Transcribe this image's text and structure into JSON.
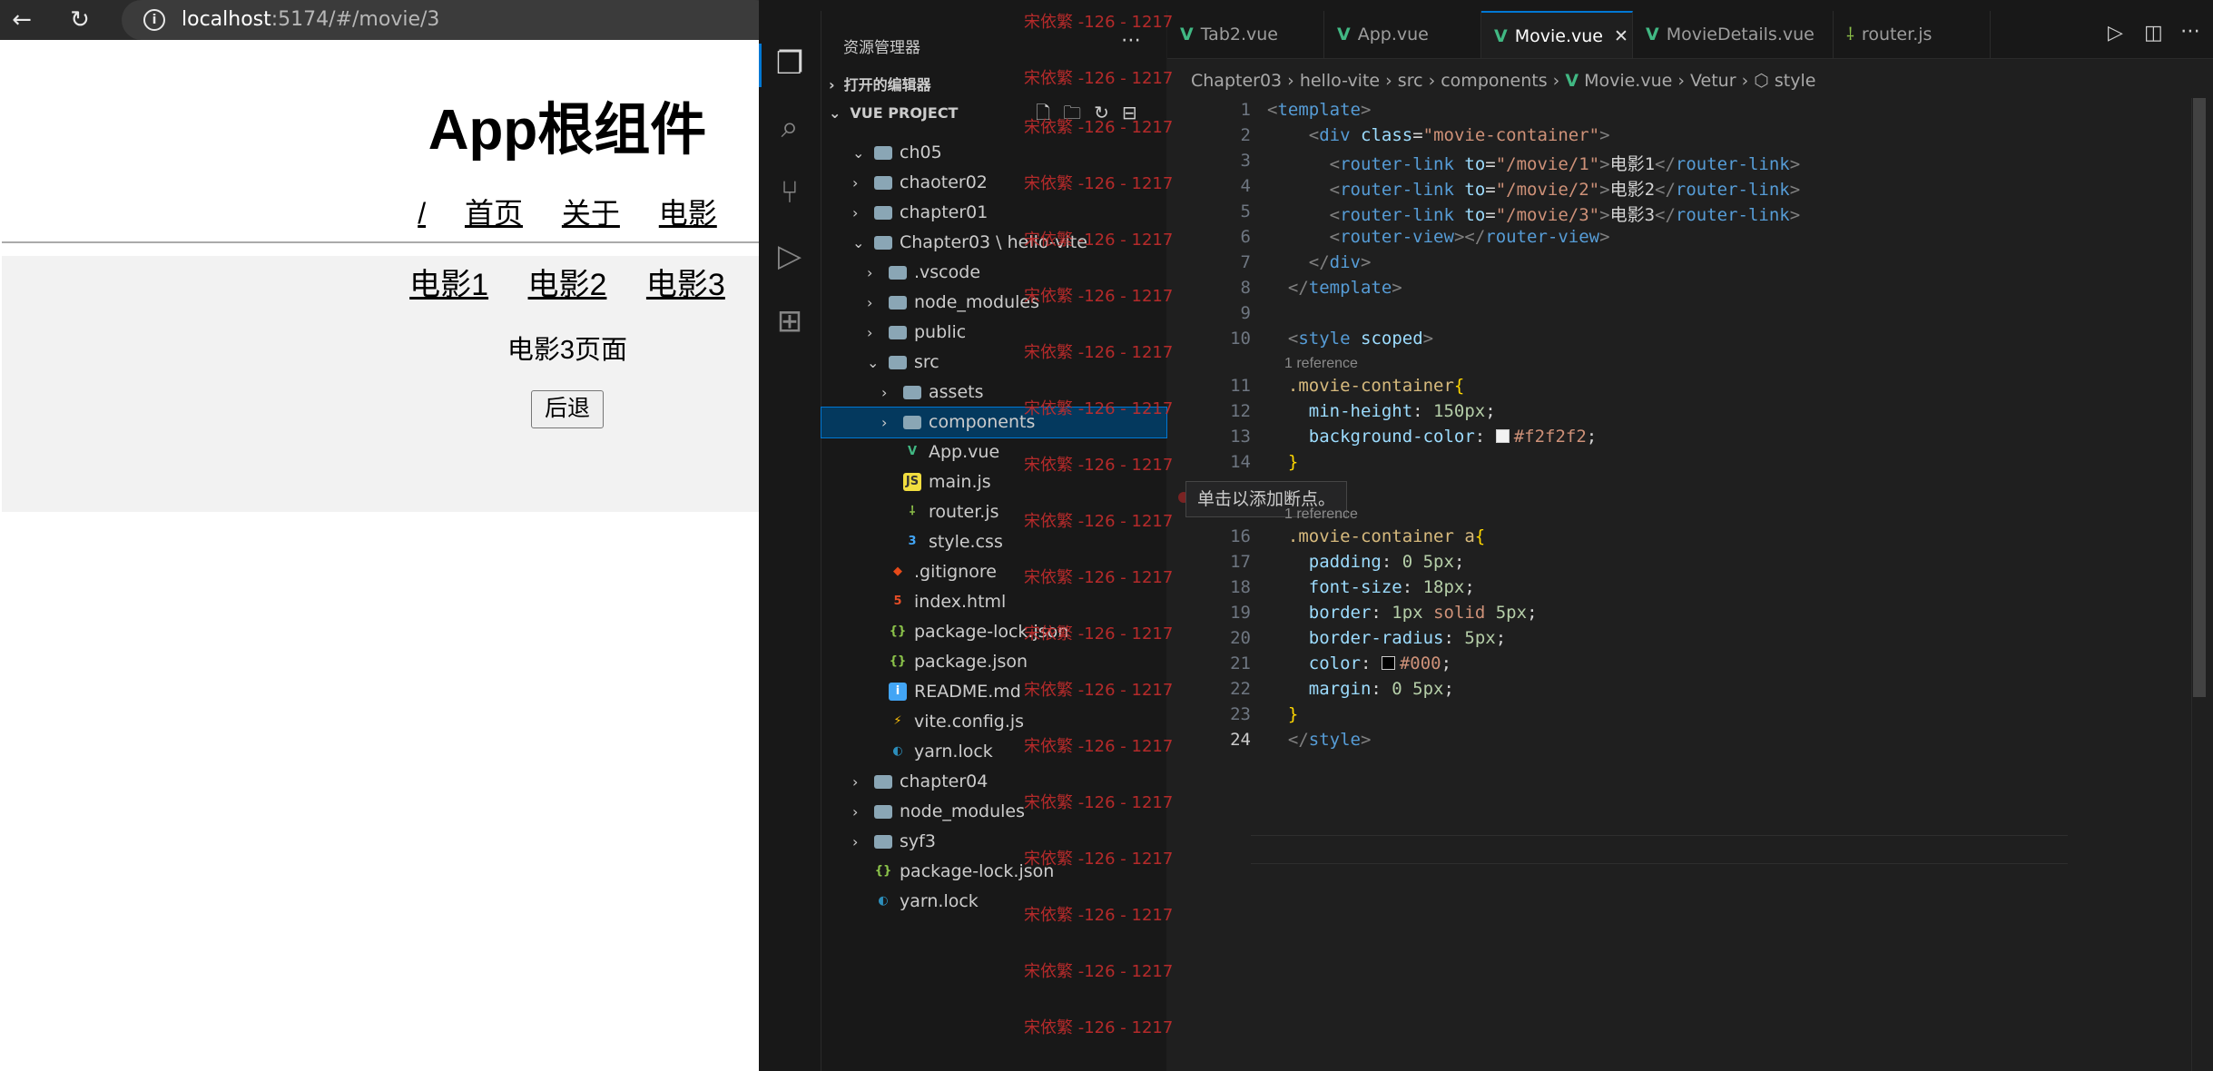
{
  "browser": {
    "back_icon": "arrow-left-icon",
    "reload_icon": "reload-icon",
    "url_host": "localhost",
    "url_path": ":5174/#/movie/3",
    "app_title": "App根组件",
    "nav": [
      "/",
      "首页",
      "关于",
      "电影"
    ],
    "movie_links": [
      "电影1",
      "电影2",
      "电影3"
    ],
    "movie_page_text": "电影3页面",
    "back_button": "后退"
  },
  "vscode": {
    "explorer_title": "资源管理器",
    "open_editors": "打开的编辑器",
    "project": "VUE PROJECT",
    "tree": [
      {
        "label": "ch05",
        "depth": 1,
        "type": "folder",
        "open": true
      },
      {
        "label": "chaoter02",
        "depth": 1,
        "type": "folder",
        "open": false
      },
      {
        "label": "chapter01",
        "depth": 1,
        "type": "folder",
        "open": false
      },
      {
        "label": "Chapter03 \\ hello-vite",
        "depth": 1,
        "type": "folder",
        "open": true
      },
      {
        "label": ".vscode",
        "depth": 2,
        "type": "folder",
        "open": false
      },
      {
        "label": "node_modules",
        "depth": 2,
        "type": "folder",
        "open": false
      },
      {
        "label": "public",
        "depth": 2,
        "type": "folder",
        "open": false
      },
      {
        "label": "src",
        "depth": 2,
        "type": "folder",
        "open": true
      },
      {
        "label": "assets",
        "depth": 3,
        "type": "folder",
        "open": false
      },
      {
        "label": "components",
        "depth": 3,
        "type": "folder",
        "open": false
      },
      {
        "label": "App.vue",
        "depth": 3,
        "type": "vue"
      },
      {
        "label": "main.js",
        "depth": 3,
        "type": "js"
      },
      {
        "label": "router.js",
        "depth": 3,
        "type": "router"
      },
      {
        "label": "style.css",
        "depth": 3,
        "type": "css"
      },
      {
        "label": ".gitignore",
        "depth": 2,
        "type": "git"
      },
      {
        "label": "index.html",
        "depth": 2,
        "type": "html"
      },
      {
        "label": "package-lock.json",
        "depth": 2,
        "type": "json"
      },
      {
        "label": "package.json",
        "depth": 2,
        "type": "json"
      },
      {
        "label": "README.md",
        "depth": 2,
        "type": "info"
      },
      {
        "label": "vite.config.js",
        "depth": 2,
        "type": "vite"
      },
      {
        "label": "yarn.lock",
        "depth": 2,
        "type": "yarn"
      },
      {
        "label": "chapter04",
        "depth": 1,
        "type": "folder",
        "open": false
      },
      {
        "label": "node_modules",
        "depth": 1,
        "type": "folder",
        "open": false
      },
      {
        "label": "syf3",
        "depth": 1,
        "type": "folder",
        "open": false
      },
      {
        "label": "package-lock.json",
        "depth": 1,
        "type": "json"
      },
      {
        "label": "yarn.lock",
        "depth": 1,
        "type": "yarn"
      }
    ],
    "selected_item": "components",
    "watermark": "宋依繁 -126 - 1217",
    "tabs": [
      {
        "label": "Tab2.vue",
        "kind": "vue"
      },
      {
        "label": "App.vue",
        "kind": "vue"
      },
      {
        "label": "Movie.vue",
        "kind": "vue",
        "active": true
      },
      {
        "label": "MovieDetails.vue",
        "kind": "vue"
      },
      {
        "label": "router.js",
        "kind": "router"
      }
    ],
    "breadcrumb": [
      "Chapter03",
      "hello-vite",
      "src",
      "components",
      "Movie.vue",
      "Vetur",
      "style"
    ],
    "codelens": "1 reference",
    "tooltip": "单击以添加断点。",
    "current_line": 24,
    "line_numbers": [
      1,
      2,
      3,
      4,
      5,
      6,
      7,
      8,
      9,
      10,
      11,
      12,
      13,
      14,
      16,
      17,
      18,
      19,
      20,
      21,
      22,
      23,
      24
    ],
    "colors": {
      "vue": "#41b883",
      "accent": "#0078d4",
      "watermark": "#c72d2d",
      "swatch_f2": "#f2f2f2",
      "swatch_000": "#000000"
    }
  }
}
